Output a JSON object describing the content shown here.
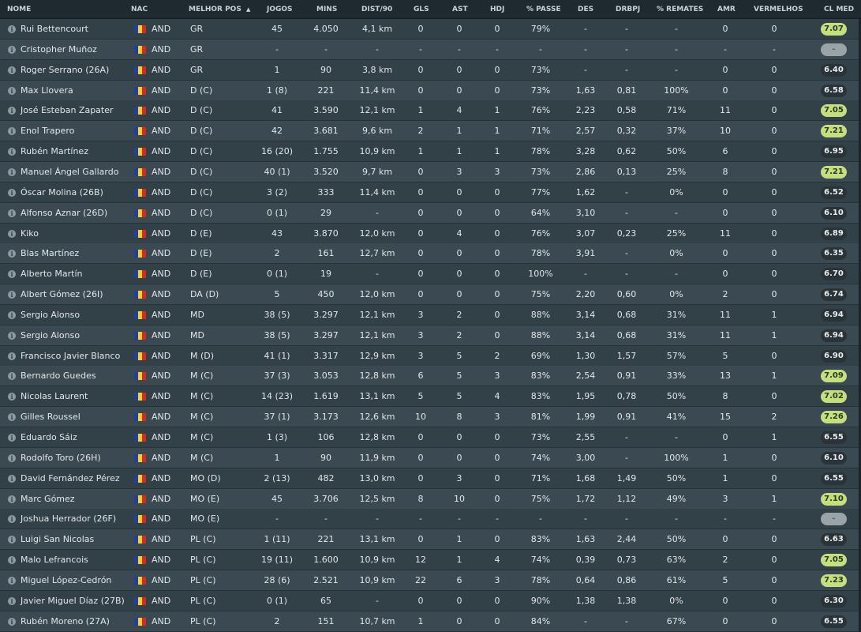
{
  "columns": {
    "name": "NOME",
    "nat": "NAC",
    "pos": "MELHOR POS",
    "apps": "JOGOS",
    "mins": "MINS",
    "dist": "DIST/90",
    "gls": "GLS",
    "ast": "AST",
    "hdj": "HDJ",
    "pass": "% PASSE",
    "des": "DES",
    "drbpj": "DRBPJ",
    "shots": "% REMATES",
    "amr": "AMR",
    "verm": "VERMELHOS",
    "rating": "CL MED"
  },
  "players": [
    {
      "name": "Rui Bettencourt",
      "nat": "AND",
      "pos": "GR",
      "apps": "45",
      "mins": "4.050",
      "dist": "4,1 km",
      "gls": "0",
      "ast": "0",
      "hdj": "0",
      "pass": "79%",
      "des": "-",
      "drbpj": "-",
      "shots": "-",
      "amr": "0",
      "verm": "0",
      "rating": "7.07",
      "tier": "hi"
    },
    {
      "name": "Cristopher Muñoz",
      "nat": "AND",
      "pos": "GR",
      "apps": "-",
      "mins": "-",
      "dist": "-",
      "gls": "-",
      "ast": "-",
      "hdj": "-",
      "pass": "-",
      "des": "-",
      "drbpj": "-",
      "shots": "-",
      "amr": "-",
      "verm": "-",
      "rating": "-",
      "tier": "none"
    },
    {
      "name": "Roger Serrano (26A)",
      "nat": "AND",
      "pos": "GR",
      "apps": "1",
      "mins": "90",
      "dist": "3,8 km",
      "gls": "0",
      "ast": "0",
      "hdj": "0",
      "pass": "73%",
      "des": "-",
      "drbpj": "-",
      "shots": "-",
      "amr": "0",
      "verm": "0",
      "rating": "6.40",
      "tier": "lo"
    },
    {
      "name": "Max Llovera",
      "nat": "AND",
      "pos": "D (C)",
      "apps": "1 (8)",
      "mins": "221",
      "dist": "11,4 km",
      "gls": "0",
      "ast": "0",
      "hdj": "0",
      "pass": "73%",
      "des": "1,63",
      "drbpj": "0,81",
      "shots": "100%",
      "amr": "0",
      "verm": "0",
      "rating": "6.58",
      "tier": "lo"
    },
    {
      "name": "José Esteban Zapater",
      "nat": "AND",
      "pos": "D (C)",
      "apps": "41",
      "mins": "3.590",
      "dist": "12,1 km",
      "gls": "1",
      "ast": "4",
      "hdj": "1",
      "pass": "76%",
      "des": "2,23",
      "drbpj": "0,58",
      "shots": "71%",
      "amr": "11",
      "verm": "0",
      "rating": "7.05",
      "tier": "hi"
    },
    {
      "name": "Enol Trapero",
      "nat": "AND",
      "pos": "D (C)",
      "apps": "42",
      "mins": "3.681",
      "dist": "9,6 km",
      "gls": "2",
      "ast": "1",
      "hdj": "1",
      "pass": "71%",
      "des": "2,57",
      "drbpj": "0,32",
      "shots": "37%",
      "amr": "10",
      "verm": "0",
      "rating": "7.21",
      "tier": "hi"
    },
    {
      "name": "Rubén Martínez",
      "nat": "AND",
      "pos": "D (C)",
      "apps": "16 (20)",
      "mins": "1.755",
      "dist": "10,9 km",
      "gls": "1",
      "ast": "1",
      "hdj": "1",
      "pass": "78%",
      "des": "3,28",
      "drbpj": "0,62",
      "shots": "50%",
      "amr": "6",
      "verm": "0",
      "rating": "6.95",
      "tier": "lo"
    },
    {
      "name": "Manuel Ángel Gallardo",
      "nat": "AND",
      "pos": "D (C)",
      "apps": "40 (1)",
      "mins": "3.520",
      "dist": "9,7 km",
      "gls": "0",
      "ast": "3",
      "hdj": "3",
      "pass": "73%",
      "des": "2,86",
      "drbpj": "0,13",
      "shots": "25%",
      "amr": "8",
      "verm": "0",
      "rating": "7.21",
      "tier": "hi"
    },
    {
      "name": "Óscar Molina (26B)",
      "nat": "AND",
      "pos": "D (C)",
      "apps": "3 (2)",
      "mins": "333",
      "dist": "11,4 km",
      "gls": "0",
      "ast": "0",
      "hdj": "0",
      "pass": "77%",
      "des": "1,62",
      "drbpj": "-",
      "shots": "0%",
      "amr": "0",
      "verm": "0",
      "rating": "6.52",
      "tier": "lo"
    },
    {
      "name": "Alfonso Aznar (26D)",
      "nat": "AND",
      "pos": "D (C)",
      "apps": "0 (1)",
      "mins": "29",
      "dist": "-",
      "gls": "0",
      "ast": "0",
      "hdj": "0",
      "pass": "64%",
      "des": "3,10",
      "drbpj": "-",
      "shots": "-",
      "amr": "0",
      "verm": "0",
      "rating": "6.10",
      "tier": "lo"
    },
    {
      "name": "Kiko",
      "nat": "AND",
      "pos": "D (E)",
      "apps": "43",
      "mins": "3.870",
      "dist": "12,0 km",
      "gls": "0",
      "ast": "4",
      "hdj": "0",
      "pass": "76%",
      "des": "3,07",
      "drbpj": "0,23",
      "shots": "25%",
      "amr": "11",
      "verm": "0",
      "rating": "6.89",
      "tier": "lo"
    },
    {
      "name": "Blas Martínez",
      "nat": "AND",
      "pos": "D (E)",
      "apps": "2",
      "mins": "161",
      "dist": "12,7 km",
      "gls": "0",
      "ast": "0",
      "hdj": "0",
      "pass": "78%",
      "des": "3,91",
      "drbpj": "-",
      "shots": "0%",
      "amr": "0",
      "verm": "0",
      "rating": "6.35",
      "tier": "lo"
    },
    {
      "name": "Alberto Martín",
      "nat": "AND",
      "pos": "D (E)",
      "apps": "0 (1)",
      "mins": "19",
      "dist": "-",
      "gls": "0",
      "ast": "0",
      "hdj": "0",
      "pass": "100%",
      "des": "-",
      "drbpj": "-",
      "shots": "-",
      "amr": "0",
      "verm": "0",
      "rating": "6.70",
      "tier": "lo"
    },
    {
      "name": "Albert Gómez (26I)",
      "nat": "AND",
      "pos": "DA (D)",
      "apps": "5",
      "mins": "450",
      "dist": "12,0 km",
      "gls": "0",
      "ast": "0",
      "hdj": "0",
      "pass": "75%",
      "des": "2,20",
      "drbpj": "0,60",
      "shots": "0%",
      "amr": "2",
      "verm": "0",
      "rating": "6.74",
      "tier": "lo"
    },
    {
      "name": "Sergio Alonso",
      "nat": "AND",
      "pos": "MD",
      "apps": "38 (5)",
      "mins": "3.297",
      "dist": "12,1 km",
      "gls": "3",
      "ast": "2",
      "hdj": "0",
      "pass": "88%",
      "des": "3,14",
      "drbpj": "0,68",
      "shots": "31%",
      "amr": "11",
      "verm": "1",
      "rating": "6.94",
      "tier": "lo"
    },
    {
      "name": "Sergio Alonso",
      "nat": "AND",
      "pos": "MD",
      "apps": "38 (5)",
      "mins": "3.297",
      "dist": "12,1 km",
      "gls": "3",
      "ast": "2",
      "hdj": "0",
      "pass": "88%",
      "des": "3,14",
      "drbpj": "0,68",
      "shots": "31%",
      "amr": "11",
      "verm": "1",
      "rating": "6.94",
      "tier": "lo"
    },
    {
      "name": "Francisco Javier Blanco",
      "nat": "AND",
      "pos": "M (D)",
      "apps": "41 (1)",
      "mins": "3.317",
      "dist": "12,9 km",
      "gls": "3",
      "ast": "5",
      "hdj": "2",
      "pass": "69%",
      "des": "1,30",
      "drbpj": "1,57",
      "shots": "57%",
      "amr": "5",
      "verm": "0",
      "rating": "6.90",
      "tier": "lo"
    },
    {
      "name": "Bernardo Guedes",
      "nat": "AND",
      "pos": "M (C)",
      "apps": "37 (3)",
      "mins": "3.053",
      "dist": "12,8 km",
      "gls": "6",
      "ast": "5",
      "hdj": "3",
      "pass": "83%",
      "des": "2,54",
      "drbpj": "0,91",
      "shots": "33%",
      "amr": "13",
      "verm": "1",
      "rating": "7.09",
      "tier": "hi"
    },
    {
      "name": "Nicolas Laurent",
      "nat": "AND",
      "pos": "M (C)",
      "apps": "14 (23)",
      "mins": "1.619",
      "dist": "13,1 km",
      "gls": "5",
      "ast": "5",
      "hdj": "4",
      "pass": "83%",
      "des": "1,95",
      "drbpj": "0,78",
      "shots": "50%",
      "amr": "8",
      "verm": "0",
      "rating": "7.02",
      "tier": "hi"
    },
    {
      "name": "Gilles Roussel",
      "nat": "AND",
      "pos": "M (C)",
      "apps": "37 (1)",
      "mins": "3.173",
      "dist": "12,6 km",
      "gls": "10",
      "ast": "8",
      "hdj": "3",
      "pass": "81%",
      "des": "1,99",
      "drbpj": "0,91",
      "shots": "41%",
      "amr": "15",
      "verm": "2",
      "rating": "7.26",
      "tier": "hi"
    },
    {
      "name": "Eduardo Sáiz",
      "nat": "AND",
      "pos": "M (C)",
      "apps": "1 (3)",
      "mins": "106",
      "dist": "12,8 km",
      "gls": "0",
      "ast": "0",
      "hdj": "0",
      "pass": "73%",
      "des": "2,55",
      "drbpj": "-",
      "shots": "-",
      "amr": "0",
      "verm": "1",
      "rating": "6.55",
      "tier": "lo"
    },
    {
      "name": "Rodolfo Toro (26H)",
      "nat": "AND",
      "pos": "M (C)",
      "apps": "1",
      "mins": "90",
      "dist": "11,9 km",
      "gls": "0",
      "ast": "0",
      "hdj": "0",
      "pass": "74%",
      "des": "3,00",
      "drbpj": "-",
      "shots": "100%",
      "amr": "1",
      "verm": "0",
      "rating": "6.10",
      "tier": "lo"
    },
    {
      "name": "David Fernández Pérez",
      "nat": "AND",
      "pos": "MO (D)",
      "apps": "2 (13)",
      "mins": "482",
      "dist": "13,0 km",
      "gls": "0",
      "ast": "3",
      "hdj": "0",
      "pass": "71%",
      "des": "1,68",
      "drbpj": "1,49",
      "shots": "50%",
      "amr": "1",
      "verm": "0",
      "rating": "6.55",
      "tier": "lo"
    },
    {
      "name": "Marc Gómez",
      "nat": "AND",
      "pos": "MO (E)",
      "apps": "45",
      "mins": "3.706",
      "dist": "12,5 km",
      "gls": "8",
      "ast": "10",
      "hdj": "0",
      "pass": "75%",
      "des": "1,72",
      "drbpj": "1,12",
      "shots": "49%",
      "amr": "3",
      "verm": "1",
      "rating": "7.10",
      "tier": "hi"
    },
    {
      "name": "Joshua Herrador (26F)",
      "nat": "AND",
      "pos": "MO (E)",
      "apps": "-",
      "mins": "-",
      "dist": "-",
      "gls": "-",
      "ast": "-",
      "hdj": "-",
      "pass": "-",
      "des": "-",
      "drbpj": "-",
      "shots": "-",
      "amr": "-",
      "verm": "-",
      "rating": "-",
      "tier": "none"
    },
    {
      "name": "Luigi San Nicolas",
      "nat": "AND",
      "pos": "PL (C)",
      "apps": "1 (11)",
      "mins": "221",
      "dist": "13,1 km",
      "gls": "0",
      "ast": "1",
      "hdj": "0",
      "pass": "83%",
      "des": "1,63",
      "drbpj": "2,44",
      "shots": "50%",
      "amr": "0",
      "verm": "0",
      "rating": "6.63",
      "tier": "lo"
    },
    {
      "name": "Malo Lefrancois",
      "nat": "AND",
      "pos": "PL (C)",
      "apps": "19 (11)",
      "mins": "1.600",
      "dist": "10,9 km",
      "gls": "12",
      "ast": "1",
      "hdj": "4",
      "pass": "74%",
      "des": "0,39",
      "drbpj": "0,73",
      "shots": "63%",
      "amr": "2",
      "verm": "0",
      "rating": "7.05",
      "tier": "hi"
    },
    {
      "name": "Miguel López-Cedrón",
      "nat": "AND",
      "pos": "PL (C)",
      "apps": "28 (6)",
      "mins": "2.521",
      "dist": "10,9 km",
      "gls": "22",
      "ast": "6",
      "hdj": "3",
      "pass": "78%",
      "des": "0,64",
      "drbpj": "0,86",
      "shots": "61%",
      "amr": "5",
      "verm": "0",
      "rating": "7.23",
      "tier": "hi"
    },
    {
      "name": "Javier Miguel Díaz (27B)",
      "nat": "AND",
      "pos": "PL (C)",
      "apps": "0 (1)",
      "mins": "65",
      "dist": "-",
      "gls": "0",
      "ast": "0",
      "hdj": "0",
      "pass": "90%",
      "des": "1,38",
      "drbpj": "1,38",
      "shots": "0%",
      "amr": "0",
      "verm": "0",
      "rating": "6.30",
      "tier": "lo"
    },
    {
      "name": "Rubén Moreno (27A)",
      "nat": "AND",
      "pos": "PL (C)",
      "apps": "2",
      "mins": "151",
      "dist": "10,7 km",
      "gls": "1",
      "ast": "0",
      "hdj": "0",
      "pass": "84%",
      "des": "-",
      "drbpj": "-",
      "shots": "67%",
      "amr": "0",
      "verm": "0",
      "rating": "6.55",
      "tier": "lo"
    }
  ]
}
